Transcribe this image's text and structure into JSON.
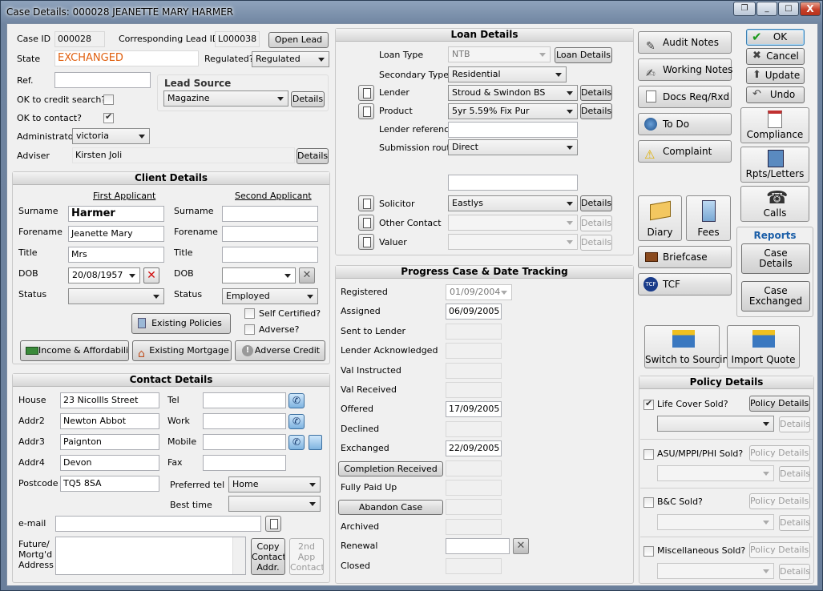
{
  "window": {
    "title": "Case Details: 000028  JEANETTE MARY HARMER",
    "min": "_",
    "max": "□",
    "close": "X",
    "restore": "❐"
  },
  "case": {
    "case_id_label": "Case ID",
    "case_id": "000028",
    "lead_id_label": "Corresponding Lead ID",
    "lead_id": "L000038",
    "open_lead": "Open Lead",
    "state_label": "State",
    "state": "EXCHANGED",
    "regulated_label": "Regulated?",
    "regulated": "Regulated",
    "ref_label": "Ref.",
    "ref": "",
    "lead_source_label": "Lead Source",
    "lead_source": "Magazine",
    "lead_source_details": "Details",
    "ok_credit_label": "OK to credit search?",
    "ok_contact_label": "OK to contact?",
    "administrator_label": "Administrator",
    "administrator": "victoria",
    "adviser_label": "Adviser",
    "adviser": "Kirsten Joli",
    "adviser_details": "Details"
  },
  "client": {
    "header": "Client Details",
    "first": "First Applicant",
    "second": "Second Applicant",
    "surname_label": "Surname",
    "forename_label": "Forename",
    "title_label": "Title",
    "dob_label": "DOB",
    "status_label": "Status",
    "first_surname": "Harmer",
    "first_forename": "Jeanette Mary",
    "first_title": "Mrs",
    "first_dob": "20/08/1957",
    "first_status": "",
    "second_surname": "",
    "second_forename": "",
    "second_title": "",
    "second_dob": "",
    "second_status": "Employed",
    "existing_policies": "Existing Policies",
    "self_certified": "Self Certified?",
    "adverse": "Adverse?",
    "income": "Income & Affordability",
    "existing_mortgage": "Existing Mortgage",
    "adverse_credit": "Adverse Credit"
  },
  "contact": {
    "header": "Contact Details",
    "house_label": "House",
    "house": "23 Nicollls Street",
    "addr2_label": "Addr2",
    "addr2": "Newton Abbot",
    "addr3_label": "Addr3",
    "addr3": "Paignton",
    "addr4_label": "Addr4",
    "addr4": "Devon",
    "postcode_label": "Postcode",
    "postcode": "TQ5 8SA",
    "tel_label": "Tel",
    "work_label": "Work",
    "mobile_label": "Mobile",
    "fax_label": "Fax",
    "preferred_tel_label": "Preferred tel",
    "preferred_tel": "Home",
    "best_time_label": "Best time",
    "best_time": "",
    "email_label": "e-mail",
    "email": "",
    "future_label": "Future/\nMortg'd\nAddress",
    "future": "",
    "copy_contact": "Copy\nContact\nAddr.",
    "second_app_contact": "2nd\nApp\nContact"
  },
  "loan": {
    "header": "Loan Details",
    "loan_type_label": "Loan Type",
    "loan_type": "NTB",
    "loan_details": "Loan Details",
    "secondary_type_label": "Secondary Type",
    "secondary_type": "Residential",
    "lender_label": "Lender",
    "lender": "Stroud & Swindon BS",
    "product_label": "Product",
    "product": "5yr 5.59% Fix Pur",
    "lender_ref_label": "Lender reference",
    "lender_ref": "",
    "submission_label": "Submission route",
    "submission": "Direct",
    "solicitor_label": "Solicitor",
    "solicitor": "Eastlys",
    "other_contact_label": "Other Contact",
    "other_contact": "",
    "valuer_label": "Valuer",
    "valuer": "",
    "details": "Details"
  },
  "progress": {
    "header": "Progress Case & Date Tracking",
    "rows": [
      {
        "label": "Registered",
        "value": "01/09/2004"
      },
      {
        "label": "Assigned",
        "value": "06/09/2005"
      },
      {
        "label": "Sent to Lender",
        "value": ""
      },
      {
        "label": "Lender Acknowledged",
        "value": ""
      },
      {
        "label": "Val Instructed",
        "value": ""
      },
      {
        "label": "Val Received",
        "value": ""
      },
      {
        "label": "Offered",
        "value": "17/09/2005"
      },
      {
        "label": "Declined",
        "value": ""
      },
      {
        "label": "Exchanged",
        "value": "22/09/2005"
      },
      {
        "label": "Completion Received",
        "value": ""
      },
      {
        "label": "Fully Paid Up",
        "value": ""
      },
      {
        "label": "Abandon Case",
        "value": ""
      },
      {
        "label": "Archived",
        "value": ""
      },
      {
        "label": "Renewal",
        "value": ""
      },
      {
        "label": "Closed",
        "value": ""
      }
    ]
  },
  "side": {
    "audit": "Audit Notes",
    "working": "Working Notes",
    "docs": "Docs Req/Rxd",
    "todo": "To Do",
    "complaint": "Complaint",
    "diary": "Diary",
    "fees": "Fees",
    "briefcase": "Briefcase",
    "tcf": "TCF",
    "switch": "Switch to Sourcing",
    "import": "Import Quote"
  },
  "actions": {
    "ok": "OK",
    "cancel": "Cancel",
    "update": "Update",
    "undo": "Undo",
    "compliance": "Compliance",
    "rpts": "Rpts/Letters",
    "calls": "Calls"
  },
  "reports": {
    "header": "Reports",
    "case_details": "Case\nDetails",
    "case_exchanged": "Case\nExchanged"
  },
  "policy": {
    "header": "Policy Details",
    "life": "Life Cover Sold?",
    "asu": "ASU/MPPI/PHI Sold?",
    "bc": "B&C Sold?",
    "misc": "Miscellaneous Sold?",
    "policy_details": "Policy Details...",
    "details": "Details"
  },
  "colors": {
    "state": "#e06010",
    "accent": "#3c7fb1"
  }
}
